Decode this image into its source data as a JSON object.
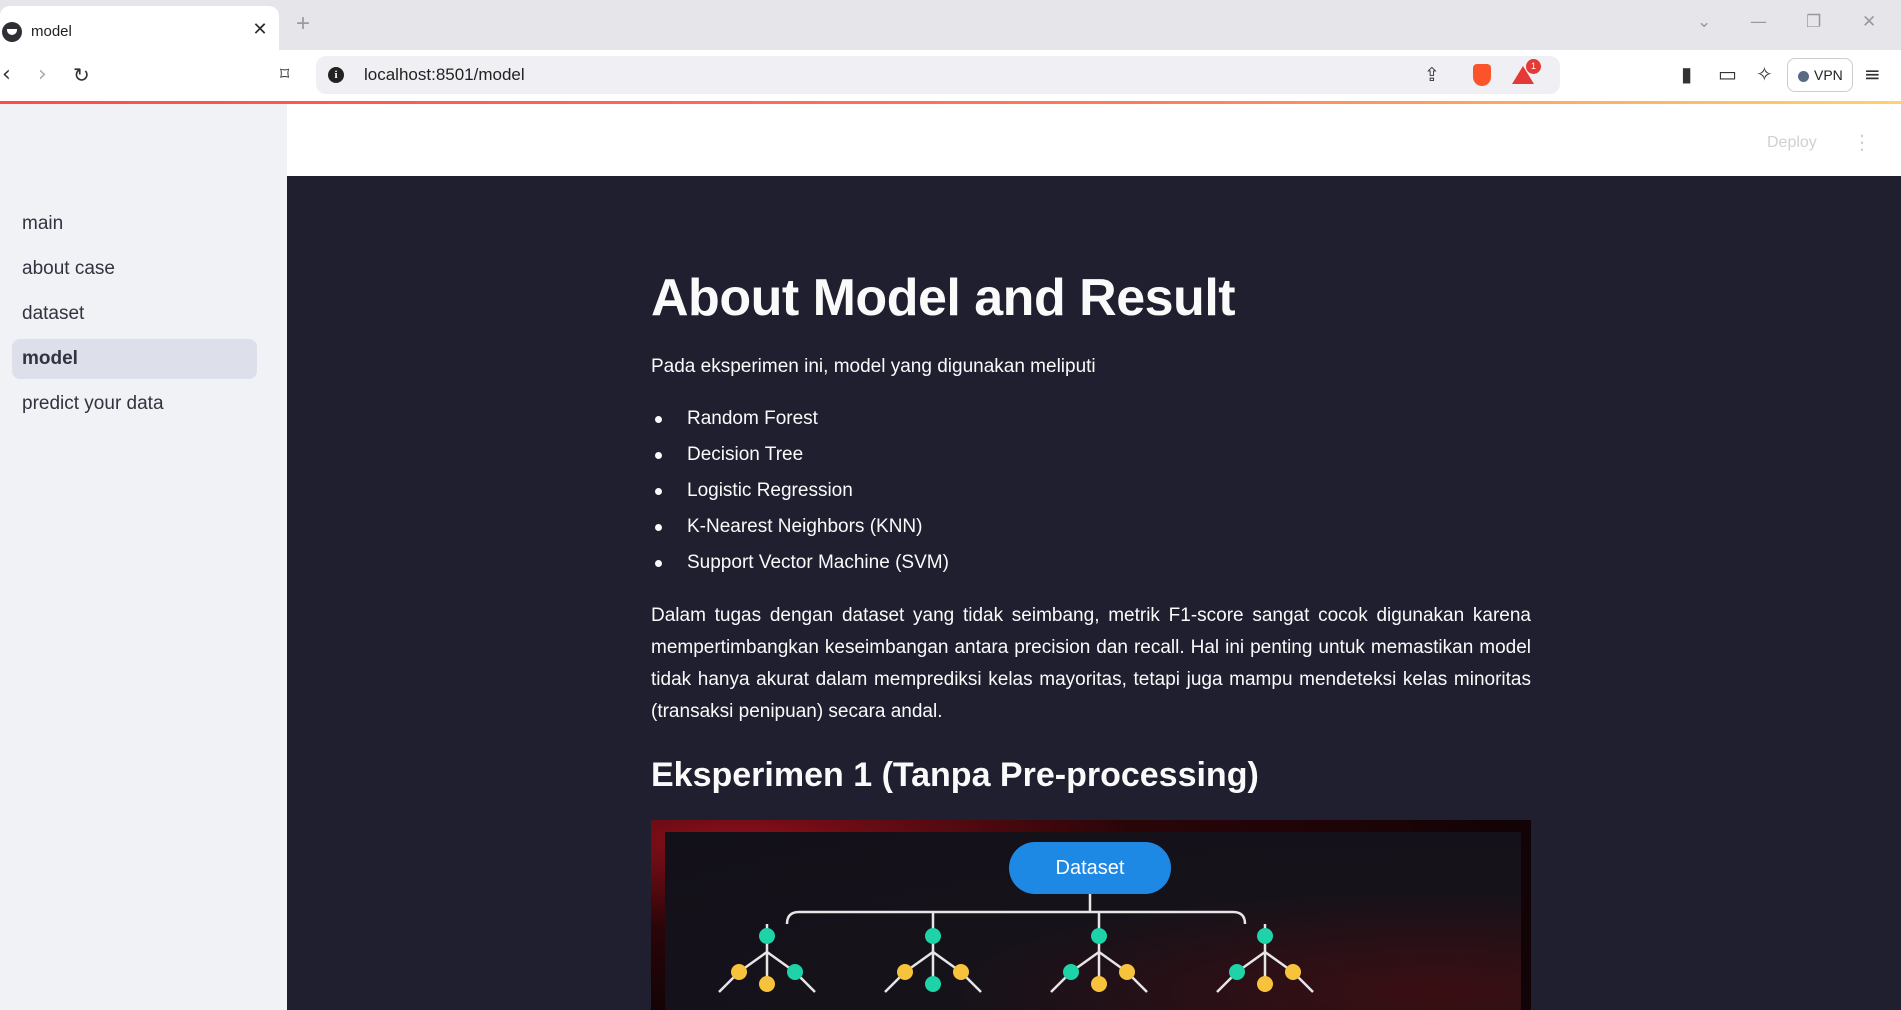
{
  "browser": {
    "tab_title": "model",
    "url": "localhost:8501/model",
    "vpn_label": "VPN",
    "notification_count": "1"
  },
  "app": {
    "deploy_label": "Deploy",
    "sidebar": {
      "items": [
        {
          "label": "main",
          "active": false
        },
        {
          "label": "about case",
          "active": false
        },
        {
          "label": "dataset",
          "active": false
        },
        {
          "label": "model",
          "active": true
        },
        {
          "label": "predict your data",
          "active": false
        }
      ]
    },
    "main": {
      "title": "About Model and Result",
      "intro": "Pada eksperimen ini, model yang digunakan meliputi",
      "models": [
        "Random Forest",
        "Decision Tree",
        "Logistic Regression",
        "K-Nearest Neighbors (KNN)",
        "Support Vector Machine (SVM)"
      ],
      "paragraph": "Dalam tugas dengan dataset yang tidak seimbang, metrik F1-score sangat cocok digunakan karena mempertimbangkan keseimbangan antara precision dan recall. Hal ini penting untuk memastikan model tidak hanya akurat dalam memprediksi kelas mayoritas, tetapi juga mampu mendeteksi kelas minoritas (transaksi penipuan) secara andal.",
      "section_heading": "Eksperimen 1 (Tanpa Pre-processing)",
      "figure": {
        "root_label": "Dataset",
        "colors": {
          "root": "#1e88e5",
          "node_green": "#1dd3a7",
          "node_yellow": "#f7c23c",
          "edge": "#e6e6e6"
        }
      }
    }
  },
  "colors": {
    "main_bg": "#1f1f2f",
    "sidebar_bg": "#f0f2f6",
    "active_item_bg": "#dde0ea",
    "text_light": "#fafafa",
    "text_dark": "#31333f"
  }
}
